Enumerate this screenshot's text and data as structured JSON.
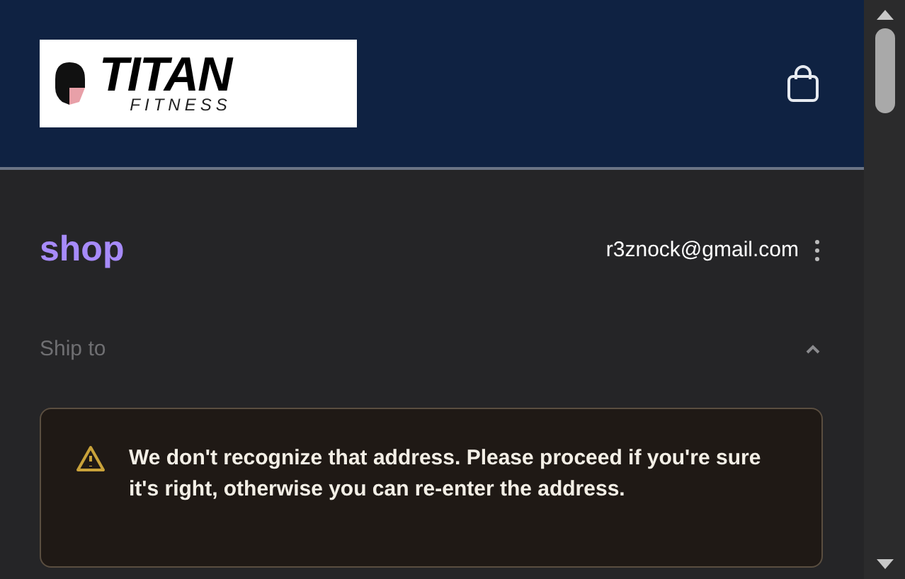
{
  "header": {
    "logo": {
      "title": "TITAN",
      "subtitle": "FITNESS"
    }
  },
  "shop": {
    "brand": "shop",
    "email": "r3znock@gmail.com"
  },
  "ship_to": {
    "label": "Ship to",
    "expanded": true
  },
  "alert": {
    "message": "We don't recognize that address. Please proceed if you're sure it's right, otherwise you can re-enter the address."
  }
}
